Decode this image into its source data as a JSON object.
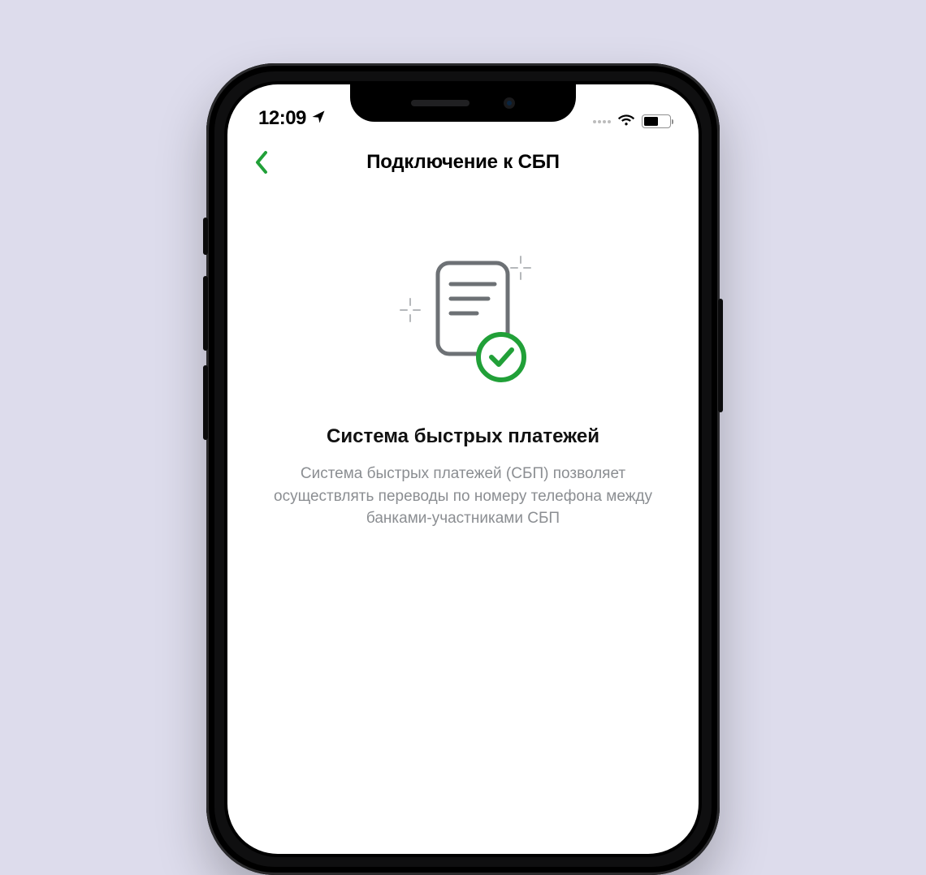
{
  "status_bar": {
    "time": "12:09"
  },
  "header": {
    "title": "Подключение к СБП"
  },
  "content": {
    "title": "Система быстрых платежей",
    "description": "Система быстрых платежей (СБП) позволяет осуществлять переводы по номеру телефона между банками-участниками СБП"
  },
  "colors": {
    "accent": "#21a038"
  }
}
